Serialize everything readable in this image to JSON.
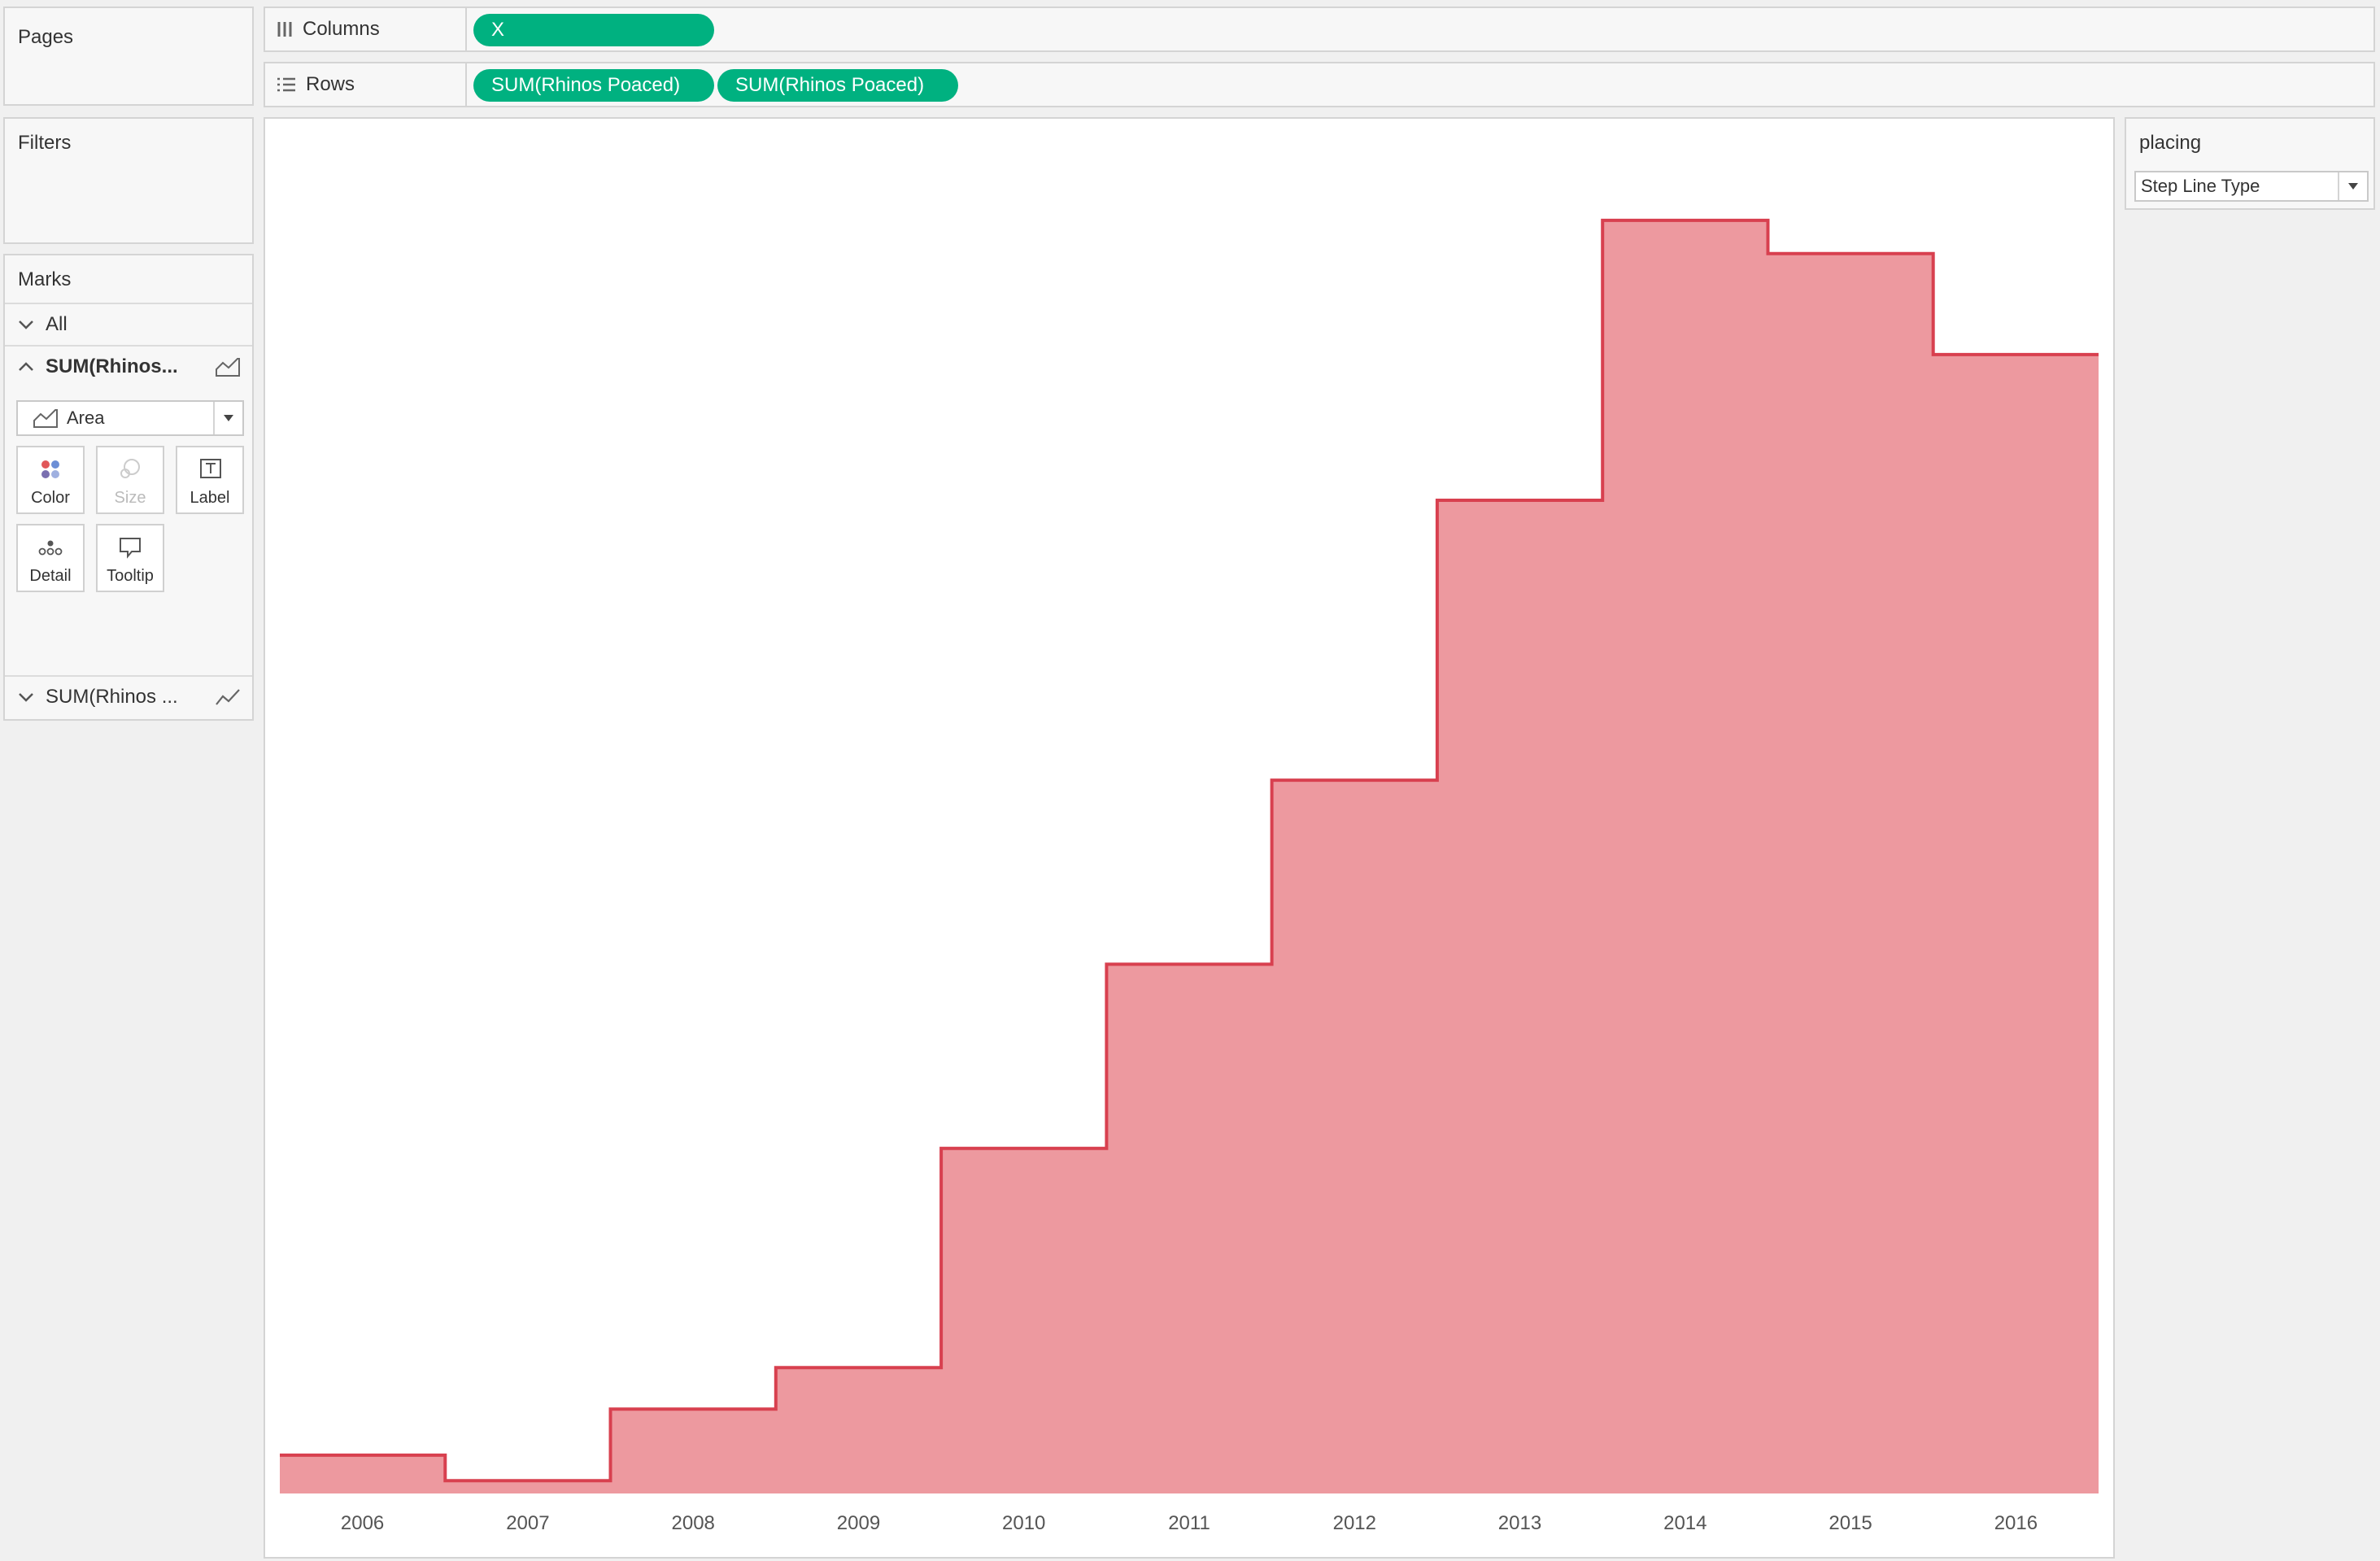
{
  "pages": {
    "title": "Pages"
  },
  "filters": {
    "title": "Filters"
  },
  "shelves": {
    "columns": {
      "label": "Columns",
      "pills": [
        "X"
      ]
    },
    "rows": {
      "label": "Rows",
      "pills": [
        "SUM(Rhinos Poaced)",
        "SUM(Rhinos Poaced)"
      ]
    }
  },
  "marks": {
    "title": "Marks",
    "all_label": "All",
    "layer1_label": "SUM(Rhinos...",
    "mark_type": "Area",
    "buttons": [
      "Color",
      "Size",
      "Label",
      "Detail",
      "Tooltip"
    ],
    "layer2_label": "SUM(Rhinos ..."
  },
  "parameter": {
    "title": "placing",
    "value": "Step Line Type"
  },
  "colors": {
    "pill": "#00b180",
    "area_fill": "#ed999f",
    "area_line": "#d8404f"
  },
  "chart_data": {
    "type": "area",
    "step": true,
    "categories": [
      "2006",
      "2007",
      "2008",
      "2009",
      "2010",
      "2011",
      "2012",
      "2013",
      "2014",
      "2015",
      "2016"
    ],
    "values": [
      60,
      20,
      132,
      197,
      540,
      828,
      1116,
      1554,
      1992,
      1940,
      1782
    ],
    "ylim": [
      0,
      2100
    ],
    "y_axis_visible": false,
    "grid": false
  }
}
